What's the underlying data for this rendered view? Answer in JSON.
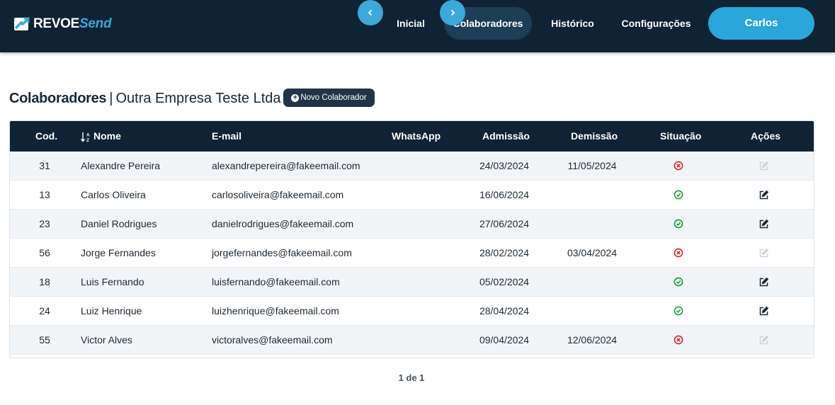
{
  "brand": {
    "part1": "REVOE",
    "part2": "Send"
  },
  "nav": {
    "items": [
      {
        "label": "Inicial",
        "active": false
      },
      {
        "label": "Colaboradores",
        "active": true
      },
      {
        "label": "Histórico",
        "active": false
      },
      {
        "label": "Configurações",
        "active": false
      }
    ],
    "user_label": "Carlos"
  },
  "page": {
    "title": "Colaboradores",
    "separator": "|",
    "company": "Outra Empresa Teste Ltda",
    "new_button_label": "Novo Colaborador"
  },
  "table": {
    "headers": {
      "cod": "Cod.",
      "nome": "Nome",
      "email": "E-mail",
      "whatsapp": "WhatsApp",
      "admissao": "Admissão",
      "demissao": "Demissão",
      "situacao": "Situação",
      "acoes": "Ações"
    },
    "sort": {
      "column": "Nome",
      "direction": "A-Z"
    },
    "rows": [
      {
        "cod": "31",
        "nome": "Alexandre Pereira",
        "email": "alexandrepereira@fakeemail.com",
        "whatsapp": "",
        "admissao": "24/03/2024",
        "demissao": "11/05/2024",
        "situacao": "inactive",
        "edit_enabled": false
      },
      {
        "cod": "13",
        "nome": "Carlos Oliveira",
        "email": "carlosoliveira@fakeemail.com",
        "whatsapp": "",
        "admissao": "16/06/2024",
        "demissao": "",
        "situacao": "active",
        "edit_enabled": true
      },
      {
        "cod": "23",
        "nome": "Daniel Rodrigues",
        "email": "danielrodrigues@fakeemail.com",
        "whatsapp": "",
        "admissao": "27/06/2024",
        "demissao": "",
        "situacao": "active",
        "edit_enabled": true
      },
      {
        "cod": "56",
        "nome": "Jorge Fernandes",
        "email": "jorgefernandes@fakeemail.com",
        "whatsapp": "",
        "admissao": "28/02/2024",
        "demissao": "03/04/2024",
        "situacao": "inactive",
        "edit_enabled": false
      },
      {
        "cod": "18",
        "nome": "Luis Fernando",
        "email": "luisfernando@fakeemail.com",
        "whatsapp": "",
        "admissao": "05/02/2024",
        "demissao": "",
        "situacao": "active",
        "edit_enabled": true
      },
      {
        "cod": "24",
        "nome": "Luiz Henrique",
        "email": "luizhenrique@fakeemail.com",
        "whatsapp": "",
        "admissao": "28/04/2024",
        "demissao": "",
        "situacao": "active",
        "edit_enabled": true
      },
      {
        "cod": "55",
        "nome": "Victor Alves",
        "email": "victoralves@fakeemail.com",
        "whatsapp": "",
        "admissao": "09/04/2024",
        "demissao": "12/06/2024",
        "situacao": "inactive",
        "edit_enabled": false
      }
    ]
  },
  "pagination": {
    "label": "1 de 1"
  },
  "colors": {
    "header_bg": "#0f2334",
    "nav_active_bg": "#1c3e57",
    "accent": "#2aa6db",
    "status_active": "#1a9a3a",
    "status_inactive": "#d9262a",
    "edit_icon": "#1f2a33",
    "edit_icon_disabled": "#d0d5da"
  },
  "icons": {
    "status_active": "check-circle-icon",
    "status_inactive": "x-circle-icon",
    "edit": "edit-icon",
    "sort": "sort-alpha-down-icon",
    "new": "plus-circle-icon",
    "prev": "chevron-left-icon",
    "next": "chevron-right-icon"
  }
}
